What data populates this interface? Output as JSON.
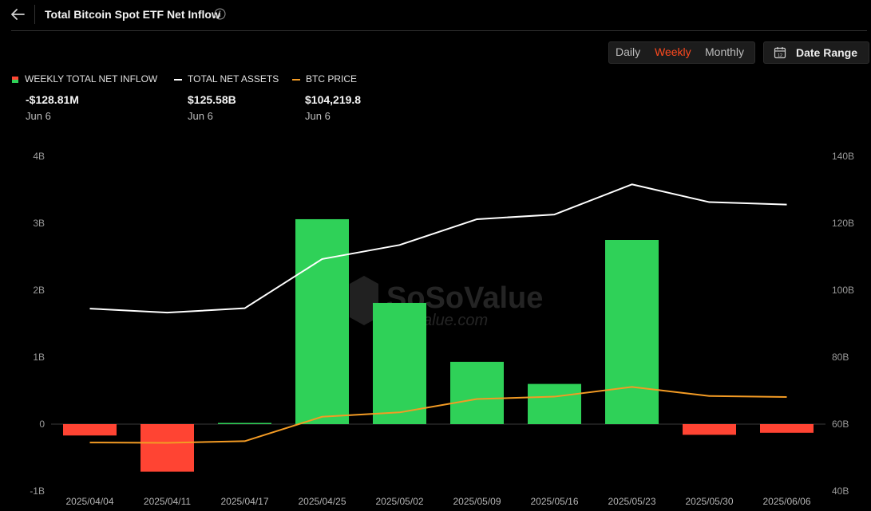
{
  "header": {
    "title": "Total Bitcoin Spot ETF Net Inflow"
  },
  "controls": {
    "periods": [
      "Daily",
      "Weekly",
      "Monthly"
    ],
    "active_period": "Weekly",
    "date_range_label": "Date Range"
  },
  "legend": [
    {
      "label": "WEEKLY TOTAL NET INFLOW",
      "value": "-$128.81M",
      "date": "Jun 6"
    },
    {
      "label": "TOTAL NET ASSETS",
      "value": "$125.58B",
      "date": "Jun 6"
    },
    {
      "label": "BTC PRICE",
      "value": "$104,219.8",
      "date": "Jun 6"
    }
  ],
  "colors": {
    "inflow_positive": "#2fd158",
    "inflow_negative": "#ff4433",
    "net_assets_line": "#ffffff",
    "btc_price_line": "#f39b24",
    "accent": "#ff4a1f"
  },
  "watermark": {
    "main": "SoSoValue",
    "sub": "alue.com"
  },
  "chart_data": {
    "type": "bar",
    "categories": [
      "2025/04/04",
      "2025/04/11",
      "2025/04/17",
      "2025/04/25",
      "2025/05/02",
      "2025/05/09",
      "2025/05/16",
      "2025/05/23",
      "2025/05/30",
      "2025/06/06"
    ],
    "series": [
      {
        "name": "WEEKLY TOTAL NET INFLOW",
        "type": "bar",
        "axis": "left",
        "values": [
          -0.17,
          -0.71,
          0.015,
          3.06,
          1.81,
          0.93,
          0.6,
          2.75,
          -0.16,
          -0.129
        ]
      },
      {
        "name": "TOTAL NET ASSETS",
        "type": "line",
        "axis": "right",
        "values": [
          94.5,
          93.3,
          94.6,
          109.3,
          113.5,
          121.2,
          122.6,
          131.6,
          126.3,
          125.58
        ]
      },
      {
        "name": "BTC PRICE",
        "type": "line",
        "axis": "right",
        "values": [
          54.5,
          54.4,
          54.9,
          62.2,
          63.5,
          67.5,
          68.2,
          71.1,
          68.4,
          68.1
        ]
      }
    ],
    "y_left": {
      "ticks": [
        "-1B",
        "0",
        "1B",
        "2B",
        "3B",
        "4B"
      ],
      "ylim": [
        -1,
        4
      ]
    },
    "y_right": {
      "ticks": [
        "40B",
        "60B",
        "80B",
        "100B",
        "120B",
        "140B"
      ],
      "ylim": [
        40,
        140
      ]
    },
    "legend_position": "top-left",
    "grid": false
  }
}
